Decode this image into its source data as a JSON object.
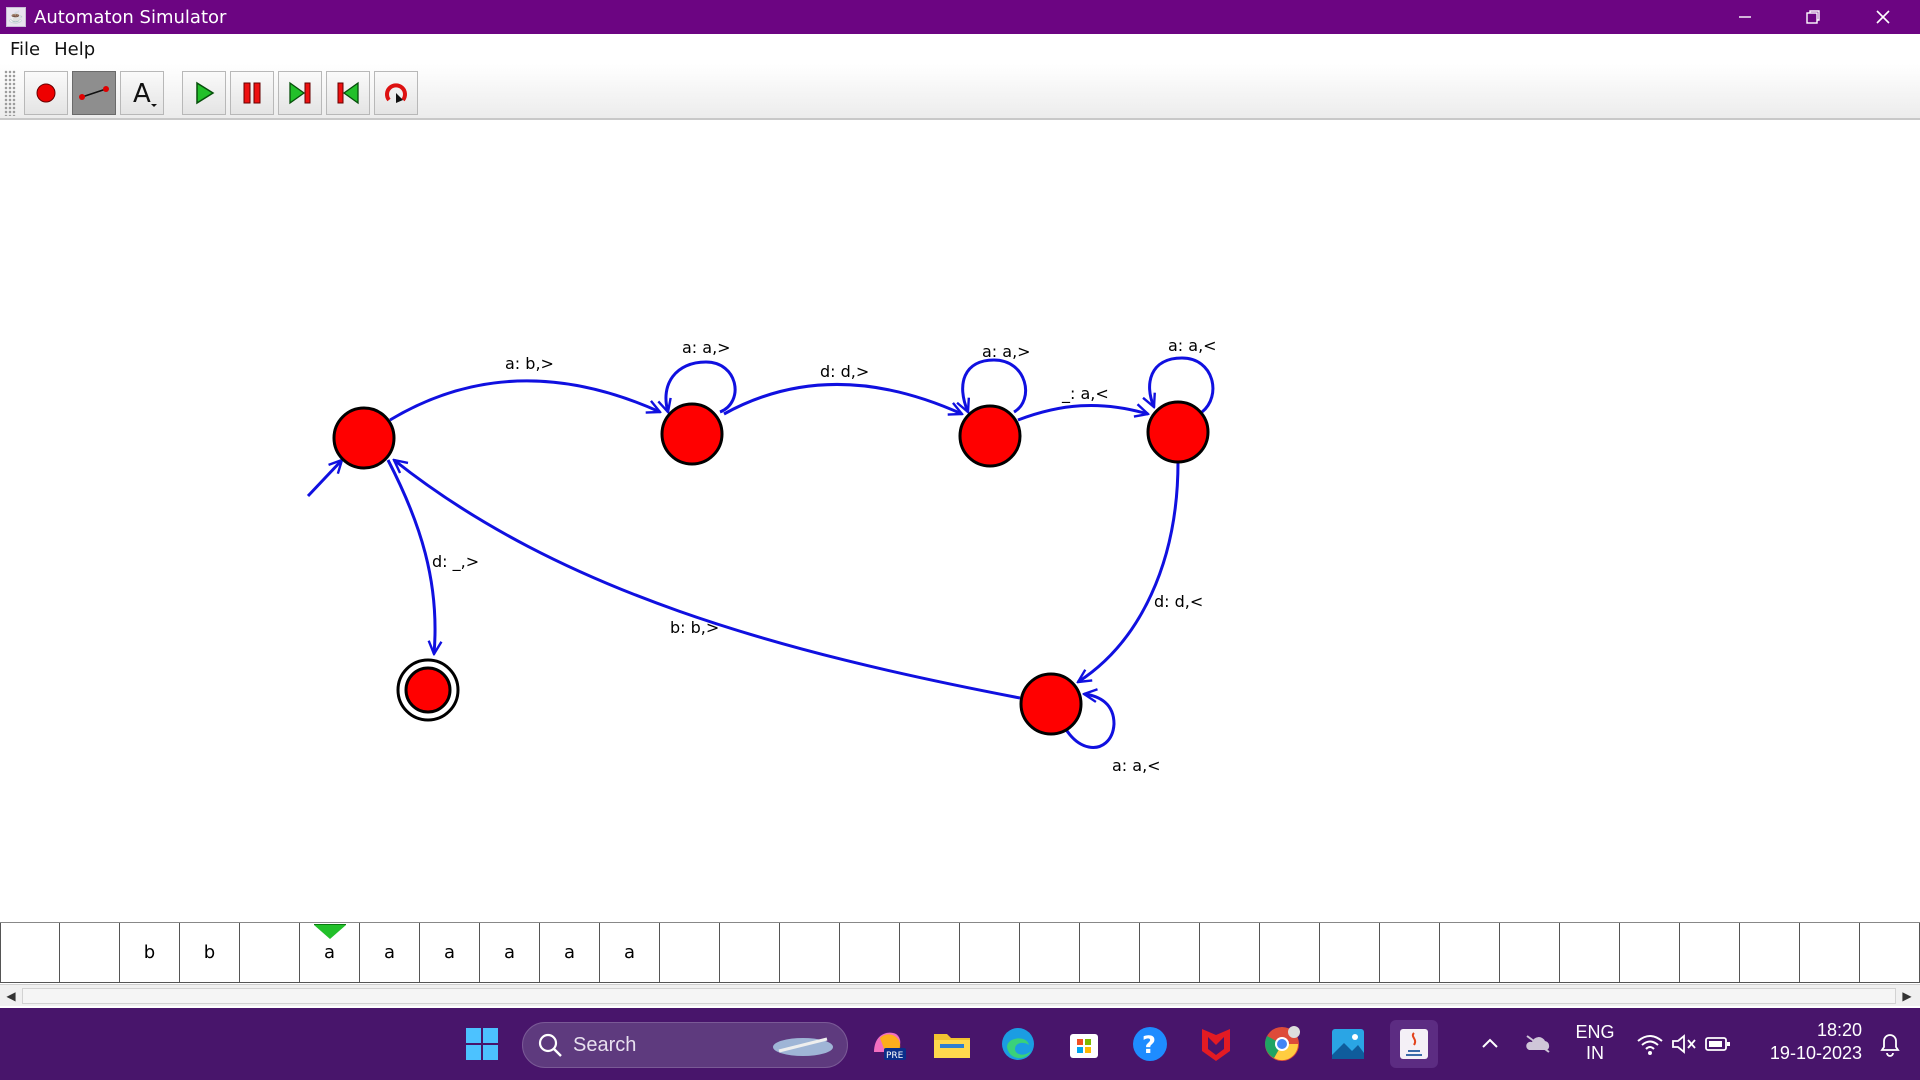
{
  "window": {
    "title": "Automaton Simulator",
    "controls": {
      "minimize": "minimize-icon",
      "restore": "restore-icon",
      "close": "close-icon"
    }
  },
  "menu": {
    "items": [
      "File",
      "Help"
    ]
  },
  "toolbar": {
    "tools": [
      {
        "name": "add-state-tool",
        "icon": "red-dot-icon"
      },
      {
        "name": "add-transition-tool",
        "icon": "transition-line-icon",
        "active": true
      },
      {
        "name": "text-tool",
        "icon": "text-a-icon"
      }
    ],
    "controls": [
      {
        "name": "run-button",
        "icon": "play-icon"
      },
      {
        "name": "pause-button",
        "icon": "pause-icon"
      },
      {
        "name": "step-forward-button",
        "icon": "step-forward-icon"
      },
      {
        "name": "step-back-button",
        "icon": "step-back-icon"
      },
      {
        "name": "reset-button",
        "icon": "reset-icon"
      }
    ]
  },
  "automaton": {
    "state_color": "#ff0000",
    "edge_color": "#1010e0",
    "labels": {
      "q0_q1": "a: b,>",
      "q1_loop": "a: a,>",
      "q1_q2": "d: d,>",
      "q2_loop": "a: a,>",
      "q2_q3": "_: a,<",
      "q3_loop": "a: a,<",
      "q3_q4": "d: d,<",
      "q4_loop": "a: a,<",
      "q4_q0": "b: b,>",
      "q0_accept": "d: _,>"
    }
  },
  "tape": {
    "cells": [
      "",
      "",
      "b",
      "b",
      "",
      "a",
      "a",
      "a",
      "a",
      "a",
      "a",
      "",
      "",
      "",
      "",
      "",
      "",
      "",
      "",
      "",
      "",
      "",
      "",
      "",
      "",
      "",
      "",
      "",
      "",
      "",
      "",
      ""
    ],
    "head_index": 5,
    "head_color": "#22c02a"
  },
  "taskbar": {
    "search_placeholder": "Search",
    "language": "ENG",
    "region": "IN",
    "time": "18:20",
    "date": "19-10-2023",
    "apps": [
      "windows-start-icon",
      "copilot-pre-icon",
      "file-explorer-icon",
      "edge-icon",
      "microsoft-store-icon",
      "help-icon",
      "mcafee-icon",
      "chrome-icon",
      "photos-icon",
      "java-icon"
    ]
  }
}
